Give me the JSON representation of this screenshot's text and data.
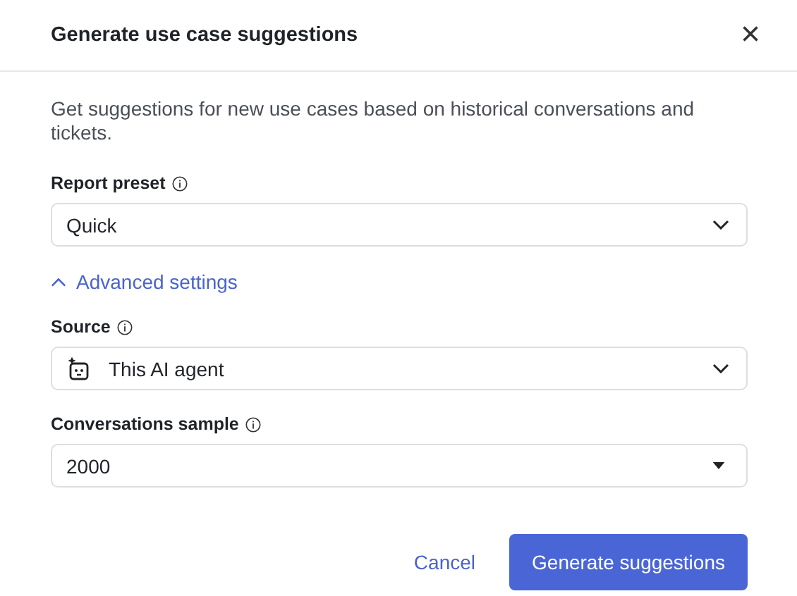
{
  "dialog": {
    "title": "Generate use case suggestions",
    "close": "×"
  },
  "description": "Get suggestions for new use cases based on historical conversations and tickets.",
  "preset": {
    "label": "Report preset",
    "kind": "select",
    "value": "Quick"
  },
  "advanced": {
    "label": "Advanced settings",
    "expanded": true
  },
  "fields": [
    {
      "label": "Source",
      "kind": "agent_select",
      "value": "This AI agent"
    },
    {
      "label": "Conversations sample",
      "kind": "combo",
      "value": "2000"
    }
  ],
  "buttons": {
    "cancel": "Cancel",
    "primary": "Generate suggestions"
  }
}
